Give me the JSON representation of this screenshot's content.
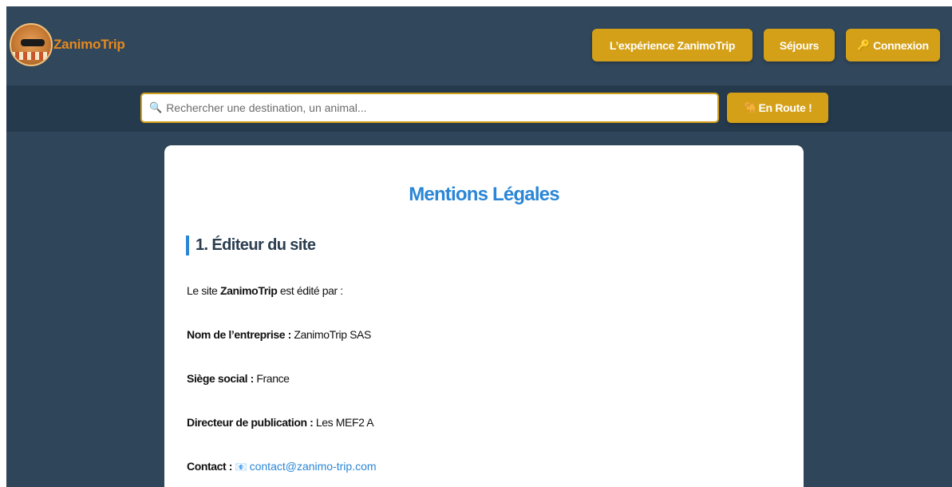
{
  "header": {
    "brand_name": "ZanimoTrip",
    "nav": {
      "experience_label": "L’expérience ZanimoTrip",
      "sejours_label": "Séjours",
      "connexion_icon": "key-icon",
      "connexion_label": "Connexion"
    }
  },
  "search": {
    "icon": "search-icon",
    "placeholder": "Rechercher une destination, un animal...",
    "value": "",
    "button_icon": "camel-icon",
    "button_label": "En Route !"
  },
  "content": {
    "title": "Mentions Légales",
    "section_1": {
      "heading": "1. Éditeur du site",
      "intro_prefix": "Le site ",
      "intro_brand": "ZanimoTrip",
      "intro_suffix": " est édité par :",
      "company_label": "Nom de l’entreprise :",
      "company_value": "ZanimoTrip SAS",
      "seat_label": "Siège social :",
      "seat_value": "France",
      "director_label": "Directeur de publication :",
      "director_value": "Les MEF2 A",
      "contact_label": "Contact :",
      "contact_icon": "mail-icon",
      "contact_email": "contact@zanimo-trip.com"
    }
  },
  "colors": {
    "background": "#2f4559",
    "header": "#31475c",
    "search_bar": "#263a4d",
    "accent_gold": "#d4a017",
    "brand_orange": "#e8891c",
    "title_blue": "#2a86d6"
  }
}
